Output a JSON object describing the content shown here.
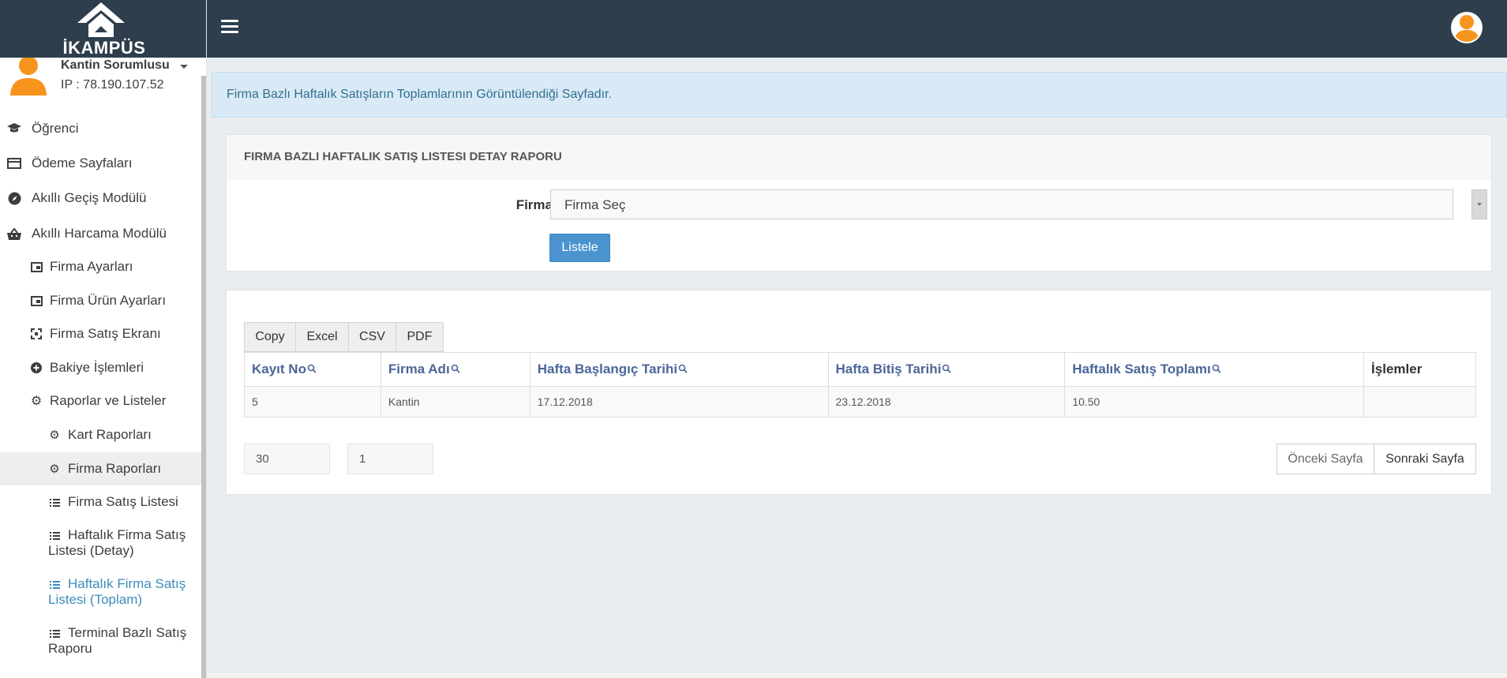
{
  "brand": {
    "logo_text": "İKAMPÜS"
  },
  "user": {
    "name": "Kantin Sorumlusu",
    "ip": "IP : 78.190.107.52"
  },
  "sidebar": {
    "items": [
      {
        "label": "Öğrenci",
        "icon": "graduation-cap-icon"
      },
      {
        "label": "Ödeme Sayfaları",
        "icon": "credit-card-icon"
      },
      {
        "label": "Akıllı Geçiş Modülü",
        "icon": "compass-icon"
      },
      {
        "label": "Akıllı Harcama Modülü",
        "icon": "basket-icon"
      }
    ],
    "sub_items": [
      {
        "label": "Firma Ayarları",
        "icon": "window-icon"
      },
      {
        "label": "Firma Ürün Ayarları",
        "icon": "window-icon"
      },
      {
        "label": "Firma Satış Ekranı",
        "icon": "expand-icon"
      },
      {
        "label": "Bakiye İşlemleri",
        "icon": "plus-circle-icon"
      },
      {
        "label": "Raporlar ve Listeler",
        "icon": "gear-icon"
      }
    ],
    "report_items": [
      {
        "label": "Kart Raporları",
        "icon": "gear-icon"
      },
      {
        "label": "Firma Raporları",
        "icon": "gear-icon"
      },
      {
        "label": "Firma Satış Listesi",
        "icon": "list-icon"
      },
      {
        "label_line1": "Haftalık Firma Satış",
        "label_line2": "Listesi (Detay)",
        "icon": "list-icon"
      },
      {
        "label_line1": "Haftalık Firma Satış",
        "label_line2": "Listesi (Toplam)",
        "icon": "list-icon"
      },
      {
        "label_line1": "Terminal Bazlı Satış",
        "label_line2": "Raporu",
        "icon": "list-icon"
      }
    ]
  },
  "info": {
    "text": "Firma Bazlı Haftalık Satışların Toplamlarının Görüntülendiği Sayfadır."
  },
  "filter": {
    "title": "FIRMA BAZLI HAFTALIK SATIŞ LISTESI DETAY RAPORU",
    "firma_label": "Firma",
    "firma_selected": "Firma Seç",
    "list_button": "Listele"
  },
  "export_buttons": [
    "Copy",
    "Excel",
    "CSV",
    "PDF"
  ],
  "table": {
    "columns": [
      "Kayıt No",
      "Firma Adı",
      "Hafta Başlangıç Tarihi",
      "Hafta Bitiş Tarihi",
      "Haftalık Satış Toplamı",
      "İşlemler"
    ],
    "rows": [
      [
        "5",
        "Kantin",
        "17.12.2018",
        "23.12.2018",
        "10.50",
        ""
      ]
    ]
  },
  "pagination": {
    "page_size": "30",
    "page_number": "1",
    "prev_label": "Önceki Sayfa",
    "next_label": "Sonraki Sayfa"
  },
  "colors": {
    "topbar": "#2e3e4c",
    "accent_blue": "#4a93cf",
    "header_link": "#4b6699",
    "avatar_orange": "#f7941d",
    "info_bg": "#d9eaf6"
  }
}
